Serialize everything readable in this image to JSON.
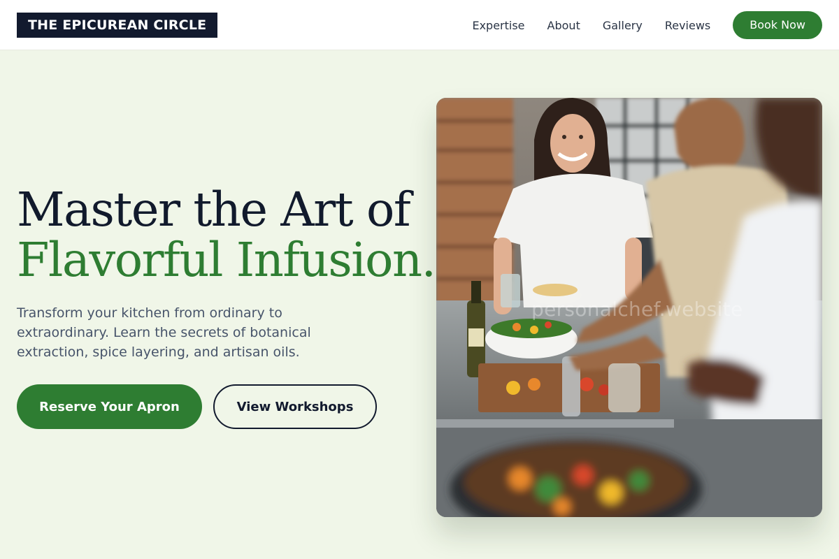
{
  "header": {
    "logo": "THE EPICUREAN CIRCLE",
    "nav": [
      "Expertise",
      "About",
      "Gallery",
      "Reviews"
    ],
    "cta": "Book Now"
  },
  "hero": {
    "title_line1": "Master the Art of",
    "title_line2": "Flavorful Infusion.",
    "subtitle": "Transform your kitchen from ordinary to extraordinary. Learn the secrets of botanical extraction, spice layering, and artisan oils.",
    "primary_button": "Reserve Your Apron",
    "secondary_button": "View Workshops"
  },
  "photo": {
    "watermark": "personalchef.website",
    "alt": "Cooking class"
  },
  "colors": {
    "accent": "#2e7d32",
    "dark": "#121a2e",
    "background": "#f0f6e8"
  }
}
